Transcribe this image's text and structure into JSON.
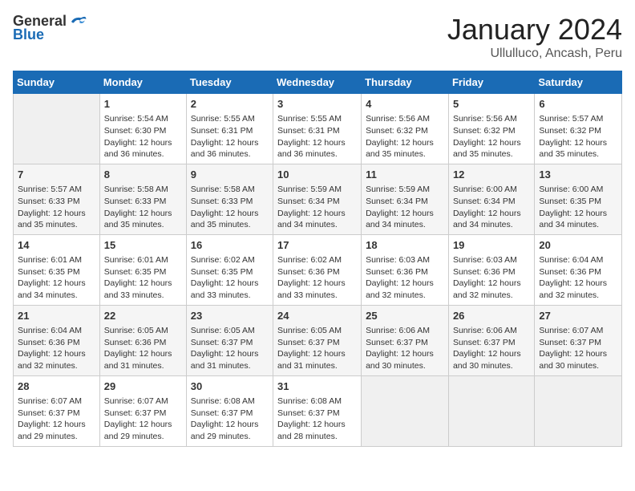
{
  "header": {
    "logo": {
      "general": "General",
      "blue": "Blue"
    },
    "title": "January 2024",
    "subtitle": "Ullulluco, Ancash, Peru"
  },
  "weekdays": [
    "Sunday",
    "Monday",
    "Tuesday",
    "Wednesday",
    "Thursday",
    "Friday",
    "Saturday"
  ],
  "weeks": [
    [
      {
        "day": "",
        "info": ""
      },
      {
        "day": "1",
        "info": "Sunrise: 5:54 AM\nSunset: 6:30 PM\nDaylight: 12 hours\nand 36 minutes."
      },
      {
        "day": "2",
        "info": "Sunrise: 5:55 AM\nSunset: 6:31 PM\nDaylight: 12 hours\nand 36 minutes."
      },
      {
        "day": "3",
        "info": "Sunrise: 5:55 AM\nSunset: 6:31 PM\nDaylight: 12 hours\nand 36 minutes."
      },
      {
        "day": "4",
        "info": "Sunrise: 5:56 AM\nSunset: 6:32 PM\nDaylight: 12 hours\nand 35 minutes."
      },
      {
        "day": "5",
        "info": "Sunrise: 5:56 AM\nSunset: 6:32 PM\nDaylight: 12 hours\nand 35 minutes."
      },
      {
        "day": "6",
        "info": "Sunrise: 5:57 AM\nSunset: 6:32 PM\nDaylight: 12 hours\nand 35 minutes."
      }
    ],
    [
      {
        "day": "7",
        "info": "Sunrise: 5:57 AM\nSunset: 6:33 PM\nDaylight: 12 hours\nand 35 minutes."
      },
      {
        "day": "8",
        "info": "Sunrise: 5:58 AM\nSunset: 6:33 PM\nDaylight: 12 hours\nand 35 minutes."
      },
      {
        "day": "9",
        "info": "Sunrise: 5:58 AM\nSunset: 6:33 PM\nDaylight: 12 hours\nand 35 minutes."
      },
      {
        "day": "10",
        "info": "Sunrise: 5:59 AM\nSunset: 6:34 PM\nDaylight: 12 hours\nand 34 minutes."
      },
      {
        "day": "11",
        "info": "Sunrise: 5:59 AM\nSunset: 6:34 PM\nDaylight: 12 hours\nand 34 minutes."
      },
      {
        "day": "12",
        "info": "Sunrise: 6:00 AM\nSunset: 6:34 PM\nDaylight: 12 hours\nand 34 minutes."
      },
      {
        "day": "13",
        "info": "Sunrise: 6:00 AM\nSunset: 6:35 PM\nDaylight: 12 hours\nand 34 minutes."
      }
    ],
    [
      {
        "day": "14",
        "info": "Sunrise: 6:01 AM\nSunset: 6:35 PM\nDaylight: 12 hours\nand 34 minutes."
      },
      {
        "day": "15",
        "info": "Sunrise: 6:01 AM\nSunset: 6:35 PM\nDaylight: 12 hours\nand 33 minutes."
      },
      {
        "day": "16",
        "info": "Sunrise: 6:02 AM\nSunset: 6:35 PM\nDaylight: 12 hours\nand 33 minutes."
      },
      {
        "day": "17",
        "info": "Sunrise: 6:02 AM\nSunset: 6:36 PM\nDaylight: 12 hours\nand 33 minutes."
      },
      {
        "day": "18",
        "info": "Sunrise: 6:03 AM\nSunset: 6:36 PM\nDaylight: 12 hours\nand 32 minutes."
      },
      {
        "day": "19",
        "info": "Sunrise: 6:03 AM\nSunset: 6:36 PM\nDaylight: 12 hours\nand 32 minutes."
      },
      {
        "day": "20",
        "info": "Sunrise: 6:04 AM\nSunset: 6:36 PM\nDaylight: 12 hours\nand 32 minutes."
      }
    ],
    [
      {
        "day": "21",
        "info": "Sunrise: 6:04 AM\nSunset: 6:36 PM\nDaylight: 12 hours\nand 32 minutes."
      },
      {
        "day": "22",
        "info": "Sunrise: 6:05 AM\nSunset: 6:36 PM\nDaylight: 12 hours\nand 31 minutes."
      },
      {
        "day": "23",
        "info": "Sunrise: 6:05 AM\nSunset: 6:37 PM\nDaylight: 12 hours\nand 31 minutes."
      },
      {
        "day": "24",
        "info": "Sunrise: 6:05 AM\nSunset: 6:37 PM\nDaylight: 12 hours\nand 31 minutes."
      },
      {
        "day": "25",
        "info": "Sunrise: 6:06 AM\nSunset: 6:37 PM\nDaylight: 12 hours\nand 30 minutes."
      },
      {
        "day": "26",
        "info": "Sunrise: 6:06 AM\nSunset: 6:37 PM\nDaylight: 12 hours\nand 30 minutes."
      },
      {
        "day": "27",
        "info": "Sunrise: 6:07 AM\nSunset: 6:37 PM\nDaylight: 12 hours\nand 30 minutes."
      }
    ],
    [
      {
        "day": "28",
        "info": "Sunrise: 6:07 AM\nSunset: 6:37 PM\nDaylight: 12 hours\nand 29 minutes."
      },
      {
        "day": "29",
        "info": "Sunrise: 6:07 AM\nSunset: 6:37 PM\nDaylight: 12 hours\nand 29 minutes."
      },
      {
        "day": "30",
        "info": "Sunrise: 6:08 AM\nSunset: 6:37 PM\nDaylight: 12 hours\nand 29 minutes."
      },
      {
        "day": "31",
        "info": "Sunrise: 6:08 AM\nSunset: 6:37 PM\nDaylight: 12 hours\nand 28 minutes."
      },
      {
        "day": "",
        "info": ""
      },
      {
        "day": "",
        "info": ""
      },
      {
        "day": "",
        "info": ""
      }
    ]
  ]
}
